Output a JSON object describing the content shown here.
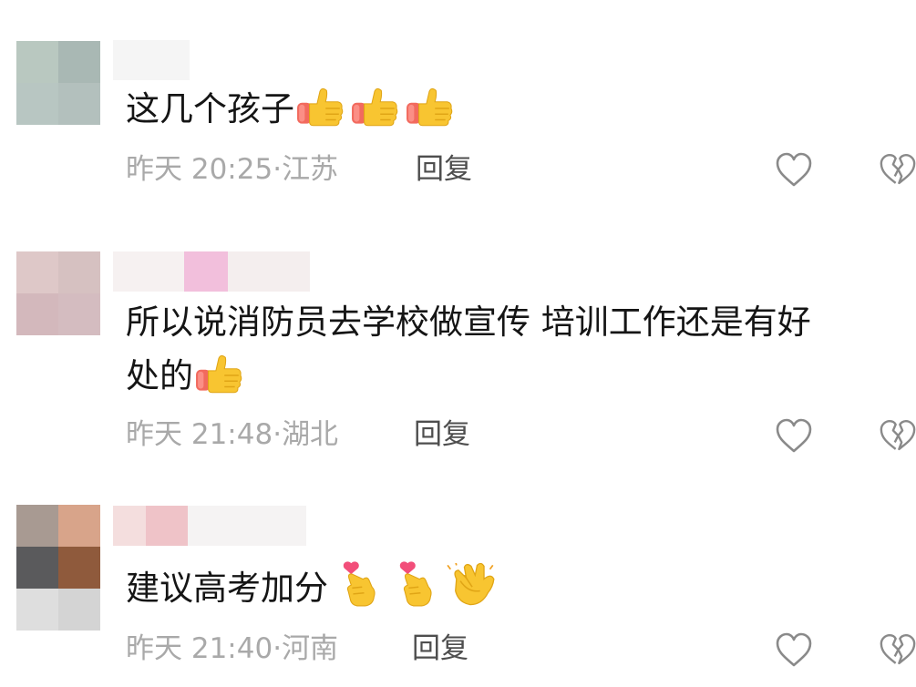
{
  "comments": [
    {
      "text": "这几个孩子",
      "time": "昨天 20:25",
      "location": "江苏",
      "reply_label": "回复",
      "emojis": [
        "thumbs-up-icon",
        "thumbs-up-icon",
        "thumbs-up-icon"
      ]
    },
    {
      "text": "所以说消防员去学校做宣传 培训工作还是有好处的",
      "text_line1": "所以说消防员去学校做宣传 培训工作还是有好",
      "text_line2": "处的",
      "time": "昨天 21:48",
      "location": "湖北",
      "reply_label": "回复",
      "emojis": [
        "thumbs-up-icon"
      ]
    },
    {
      "text": "建议高考加分",
      "time": "昨天 21:40",
      "location": "河南",
      "reply_label": "回复",
      "emojis": [
        "finger-heart-icon",
        "finger-heart-icon",
        "clapping-hands-icon"
      ]
    }
  ],
  "colors": {
    "text": "#151515",
    "meta": "#a9a9a9",
    "reply": "#4e4e4e",
    "icon_outline": "#8a8a8a",
    "emoji_yellow": "#f7c12b",
    "emoji_sleeve": "#f06a5e"
  }
}
